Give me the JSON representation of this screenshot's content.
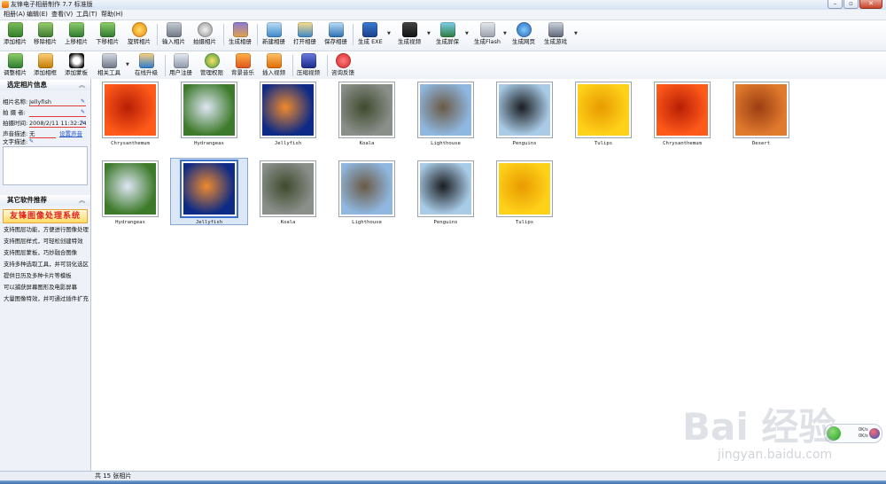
{
  "window": {
    "title": "友锋电子相册制作 7.7 标准版"
  },
  "menu": [
    "相册(A)",
    "编辑(E)",
    "查看(V)",
    "工具(T)",
    "帮助(H)"
  ],
  "toolbar1": [
    {
      "label": "添加相片",
      "icon": "add-photo-icon"
    },
    {
      "label": "移除相片",
      "icon": "remove-photo-icon"
    },
    {
      "label": "上移相片",
      "icon": "move-up-icon"
    },
    {
      "label": "下移相片",
      "icon": "move-down-icon"
    },
    {
      "label": "旋转相片",
      "icon": "rotate-icon"
    },
    {
      "label": "输入相片",
      "icon": "import-photo-icon"
    },
    {
      "label": "拍摄相片",
      "icon": "camera-icon"
    },
    {
      "label": "生成相册",
      "icon": "generate-album-icon"
    },
    {
      "label": "新建相册",
      "icon": "new-album-icon"
    },
    {
      "label": "打开相册",
      "icon": "open-album-icon"
    },
    {
      "label": "保存相册",
      "icon": "save-album-icon"
    },
    {
      "label": "生成 EXE",
      "icon": "exe-icon"
    },
    {
      "label": "生成视频",
      "icon": "video-icon"
    },
    {
      "label": "生成屏保",
      "icon": "screensaver-icon"
    },
    {
      "label": "生成Flash",
      "icon": "flash-icon"
    },
    {
      "label": "生成网页",
      "icon": "webpage-icon"
    },
    {
      "label": "生成游戏",
      "icon": "game-icon"
    }
  ],
  "toolbar2": [
    {
      "label": "调整相片",
      "icon": "adjust-photo-icon"
    },
    {
      "label": "添加相框",
      "icon": "add-frame-icon"
    },
    {
      "label": "添加蒙板",
      "icon": "add-mask-icon"
    },
    {
      "label": "相关工具",
      "icon": "tools-icon"
    },
    {
      "label": "在线升级",
      "icon": "upgrade-icon"
    },
    {
      "label": "用户注册",
      "icon": "register-icon"
    },
    {
      "label": "管理权限",
      "icon": "permission-icon"
    },
    {
      "label": "背景音乐",
      "icon": "music-icon"
    },
    {
      "label": "插入视频",
      "icon": "insert-video-icon"
    },
    {
      "label": "压缩视频",
      "icon": "compress-video-icon"
    },
    {
      "label": "咨询反馈",
      "icon": "feedback-icon"
    }
  ],
  "info": {
    "title": "选定相片信息",
    "name_label": "相片名称:",
    "name_value": "Jellyfish",
    "photographer_label": "拍 摄 者:",
    "photographer_value": "",
    "time_label": "拍摄时间:",
    "time_value": "2008/2/11 11:32:24",
    "audio_label": "声音描述:",
    "audio_value": "无",
    "audio_link": "设置声音",
    "text_label": "文字描述:",
    "edit_icon": "pencil-icon"
  },
  "recommend": {
    "title": "其它软件推荐",
    "banner": "友锋图像处理系统",
    "features": [
      "支持图层功能，方便进行图像处理",
      "支持图层样式，可轻松创建特效",
      "支持图层蒙板，巧妙融合图像",
      "支持多种选取工具，并可羽化选区",
      "提供日历及多种卡片等模板",
      "可以捕获屏幕图形及电影屏幕",
      "大量图像特效，并可通过插件扩充"
    ]
  },
  "photos": [
    {
      "name": "Chrysanthemum",
      "c1": "#ff5a1a",
      "c2": "#b81e05"
    },
    {
      "name": "Hydrangeas",
      "c1": "#3d7a2a",
      "c2": "#dfe6f4"
    },
    {
      "name": "Jellyfish",
      "c1": "#0c2a86",
      "c2": "#f08a2c"
    },
    {
      "name": "Koala",
      "c1": "#8a8f8a",
      "c2": "#3f4a2e"
    },
    {
      "name": "Lighthouse",
      "c1": "#8fb7e0",
      "c2": "#6b5a45"
    },
    {
      "name": "Penguins",
      "c1": "#a9cbe6",
      "c2": "#1a1d22"
    },
    {
      "name": "Tulips",
      "c1": "#ffd21a",
      "c2": "#e89a00"
    },
    {
      "name": "Chrysanthemum",
      "c1": "#ff5a1a",
      "c2": "#b81e05"
    },
    {
      "name": "Desert",
      "c1": "#e07b2e",
      "c2": "#9c3d12"
    },
    {
      "name": "Hydrangeas",
      "c1": "#3d7a2a",
      "c2": "#dfe6f4"
    },
    {
      "name": "Jellyfish",
      "c1": "#0c2a86",
      "c2": "#f08a2c"
    },
    {
      "name": "Koala",
      "c1": "#8a8f8a",
      "c2": "#3f4a2e"
    },
    {
      "name": "Lighthouse",
      "c1": "#8fb7e0",
      "c2": "#6b5a45"
    },
    {
      "name": "Penguins",
      "c1": "#a9cbe6",
      "c2": "#1a1d22"
    },
    {
      "name": "Tulips",
      "c1": "#ffd21a",
      "c2": "#e89a00"
    }
  ],
  "selected_photo": "Jellyfish",
  "status": {
    "text": "共 15 张相片"
  },
  "network": {
    "up": "0K/s",
    "down": "0K/s"
  },
  "watermark": {
    "text": "Bai 经验",
    "url": "jingyan.baidu.com"
  }
}
